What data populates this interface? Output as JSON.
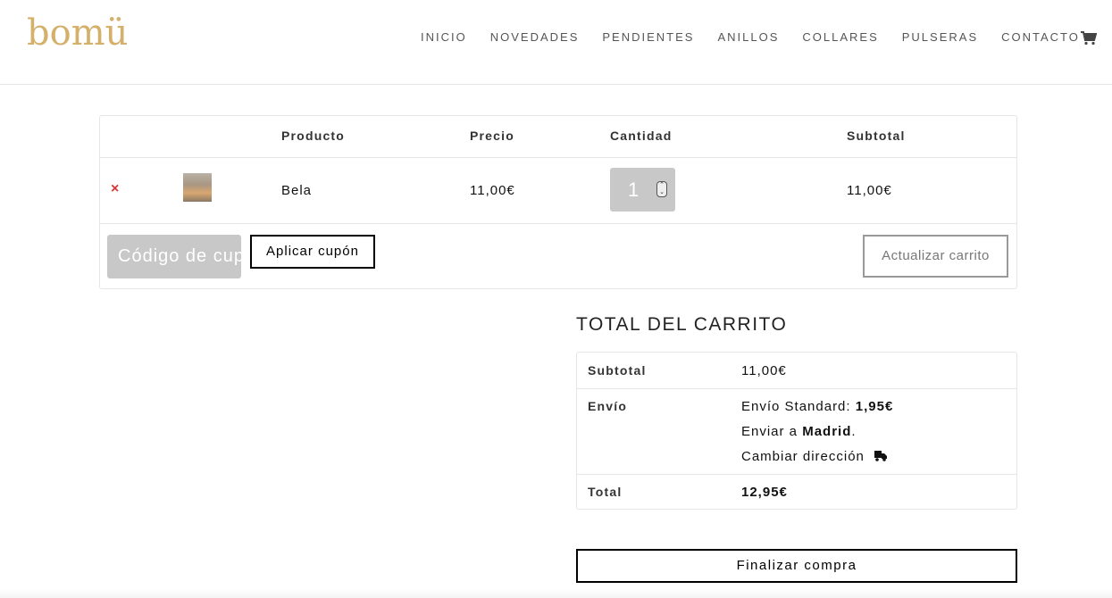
{
  "header": {
    "logo": "bomü",
    "nav": [
      "INICIO",
      "NOVEDADES",
      "PENDIENTES",
      "ANILLOS",
      "COLLARES",
      "PULSERAS",
      "CONTACTO"
    ],
    "cart_icon": "shopping-cart-icon"
  },
  "cart": {
    "columns": {
      "product": "Producto",
      "price": "Precio",
      "quantity": "Cantidad",
      "subtotal": "Subtotal"
    },
    "items": [
      {
        "name": "Bela",
        "price": "11,00€",
        "quantity": "1",
        "subtotal": "11,00€",
        "remove_icon": "remove-x-icon"
      }
    ],
    "coupon_placeholder": "Código de cupón",
    "apply_coupon_label": "Aplicar cupón",
    "update_cart_label": "Actualizar carrito"
  },
  "totals": {
    "title": "TOTAL DEL CARRITO",
    "subtotal_label": "Subtotal",
    "subtotal_value": "11,00€",
    "shipping_label": "Envío",
    "shipping_method": "Envío Standard:",
    "shipping_cost": "1,95€",
    "ship_to_prefix": "Enviar a",
    "ship_to_city": "Madrid",
    "ship_to_suffix": ".",
    "change_address": "Cambiar dirección",
    "total_label": "Total",
    "total_value": "12,95€"
  },
  "checkout_label": "Finalizar compra",
  "colors": {
    "brand_gold": "#d4b06a",
    "remove_red": "#dd3333",
    "input_gray": "#c8c8c8"
  }
}
